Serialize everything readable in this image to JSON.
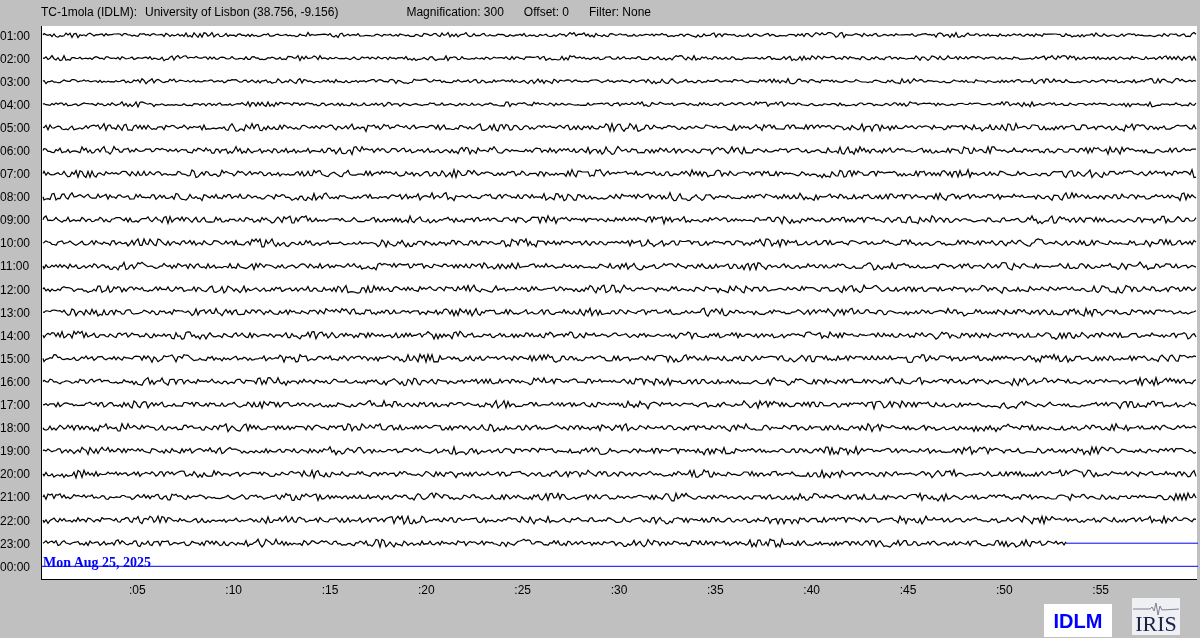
{
  "header": {
    "station": "TC-1mola (IDLM):",
    "location": "University of Lisbon (38.756, -9.156)",
    "magnification": "Magnification: 300",
    "offset": "Offset: 0",
    "filter": "Filter: None"
  },
  "helicorder": {
    "rows": [
      {
        "time": "01:00",
        "kind": "full"
      },
      {
        "time": "02:00",
        "kind": "full"
      },
      {
        "time": "03:00",
        "kind": "full"
      },
      {
        "time": "04:00",
        "kind": "full"
      },
      {
        "time": "05:00",
        "kind": "full"
      },
      {
        "time": "06:00",
        "kind": "full"
      },
      {
        "time": "07:00",
        "kind": "full"
      },
      {
        "time": "08:00",
        "kind": "full"
      },
      {
        "time": "09:00",
        "kind": "full"
      },
      {
        "time": "10:00",
        "kind": "full"
      },
      {
        "time": "11:00",
        "kind": "full"
      },
      {
        "time": "12:00",
        "kind": "full"
      },
      {
        "time": "13:00",
        "kind": "full"
      },
      {
        "time": "14:00",
        "kind": "full"
      },
      {
        "time": "15:00",
        "kind": "full"
      },
      {
        "time": "16:00",
        "kind": "full"
      },
      {
        "time": "17:00",
        "kind": "full"
      },
      {
        "time": "18:00",
        "kind": "full"
      },
      {
        "time": "19:00",
        "kind": "full"
      },
      {
        "time": "20:00",
        "kind": "full"
      },
      {
        "time": "21:00",
        "kind": "full"
      },
      {
        "time": "22:00",
        "kind": "full"
      },
      {
        "time": "23:00",
        "kind": "partial"
      },
      {
        "time": "00:00",
        "kind": "empty"
      }
    ],
    "date_label": "Mon Aug 25, 2025",
    "x_ticks": [
      ":05",
      ":10",
      ":15",
      ":20",
      ":25",
      ":30",
      ":35",
      ":40",
      ":45",
      ":50",
      ":55"
    ]
  },
  "logos": {
    "station": "IDLM",
    "network": "IRIS"
  }
}
